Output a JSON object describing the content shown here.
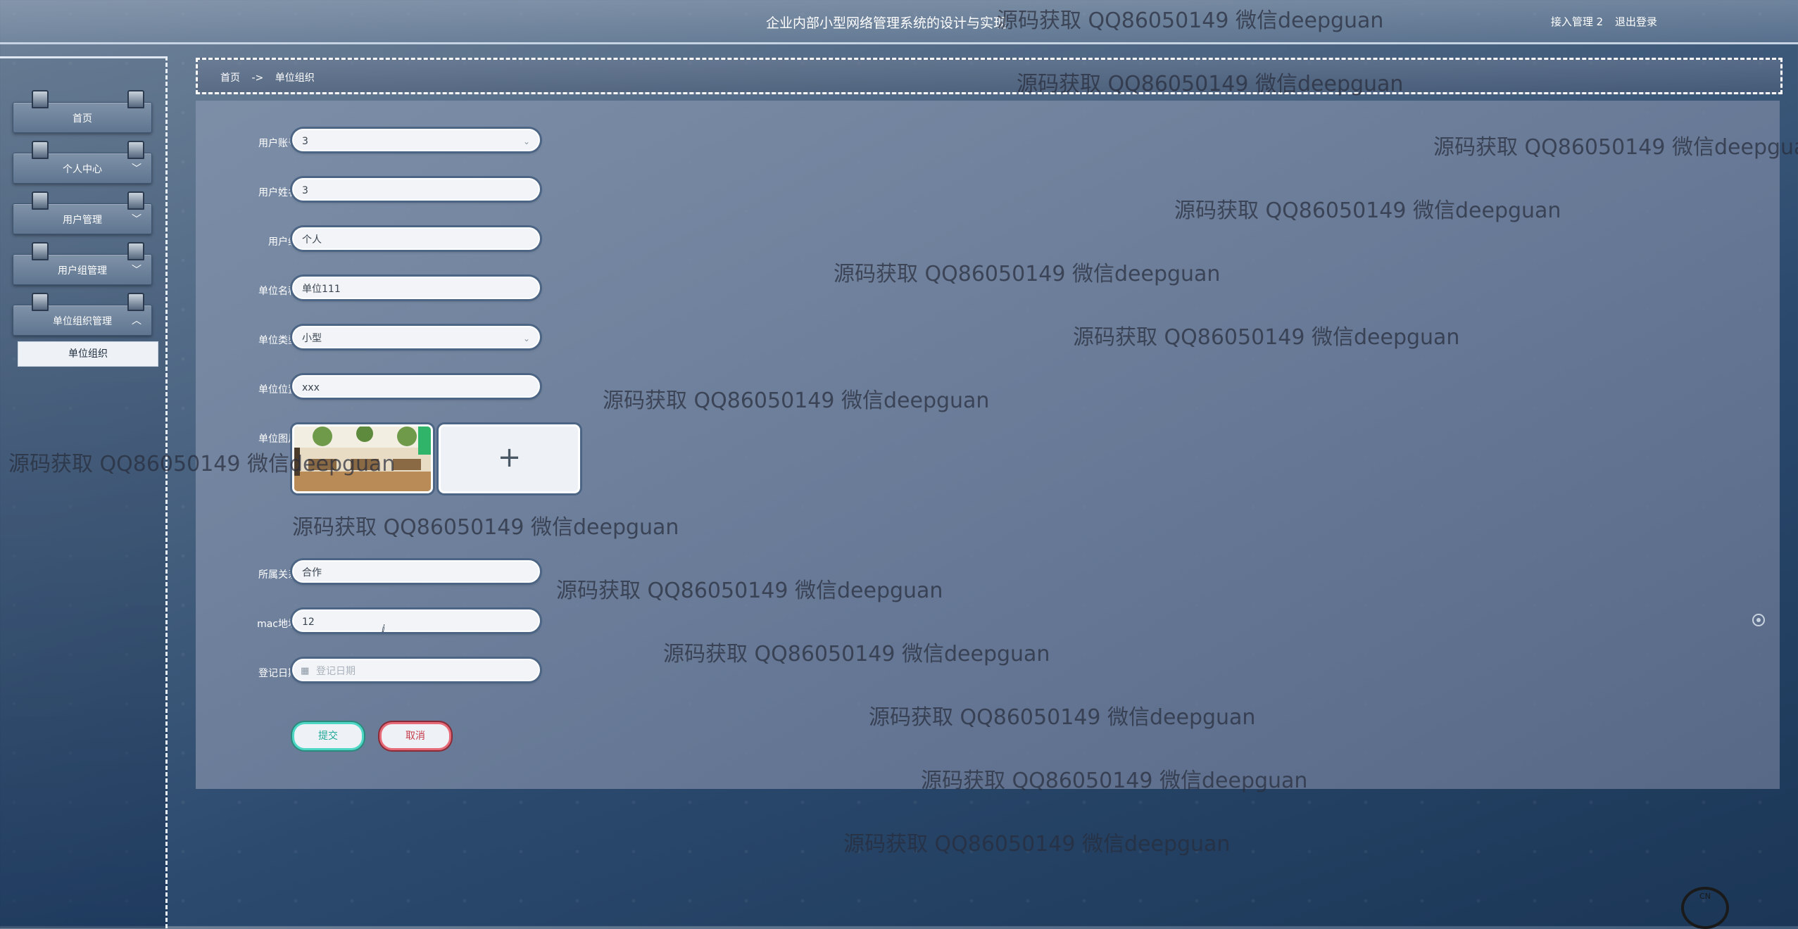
{
  "header": {
    "title": "企业内部小型网络管理系统的设计与实现",
    "user": "接入管理 2",
    "logout": "退出登录"
  },
  "sidebar": {
    "items": [
      {
        "label": "首页",
        "chevron": ""
      },
      {
        "label": "个人中心",
        "chevron": "﹀"
      },
      {
        "label": "用户管理",
        "chevron": "﹀"
      },
      {
        "label": "用户组管理",
        "chevron": "﹀"
      },
      {
        "label": "单位组织管理",
        "chevron": "︿"
      }
    ],
    "submenu": [
      "单位组织"
    ]
  },
  "breadcrumb": {
    "home": "首页",
    "separator": "->",
    "current": "单位组织"
  },
  "form": {
    "account": {
      "label": "用户账号",
      "value": "3"
    },
    "username": {
      "label": "用户姓名",
      "value": "3"
    },
    "group": {
      "label": "用户组",
      "value": "个人"
    },
    "unit_name": {
      "label": "单位名称",
      "value": "单位111"
    },
    "unit_type": {
      "label": "单位类型",
      "value": "小型"
    },
    "unit_location": {
      "label": "单位位置",
      "value": "xxx"
    },
    "unit_image": {
      "label": "单位图片",
      "upload_symbol": "+"
    },
    "relation": {
      "label": "所属关系",
      "value": "合作"
    },
    "mac": {
      "label": "mac地址",
      "value": "12"
    },
    "register_date": {
      "label": "登记日期",
      "placeholder": "登记日期"
    },
    "submit_label": "提交",
    "cancel_label": "取消"
  },
  "watermark": "源码获取 QQ86050149 微信deepguan",
  "corner_logo": "CN",
  "icons": {
    "dropdown": "chevron-down-icon",
    "calendar": "calendar-icon",
    "upload": "plus-icon"
  }
}
